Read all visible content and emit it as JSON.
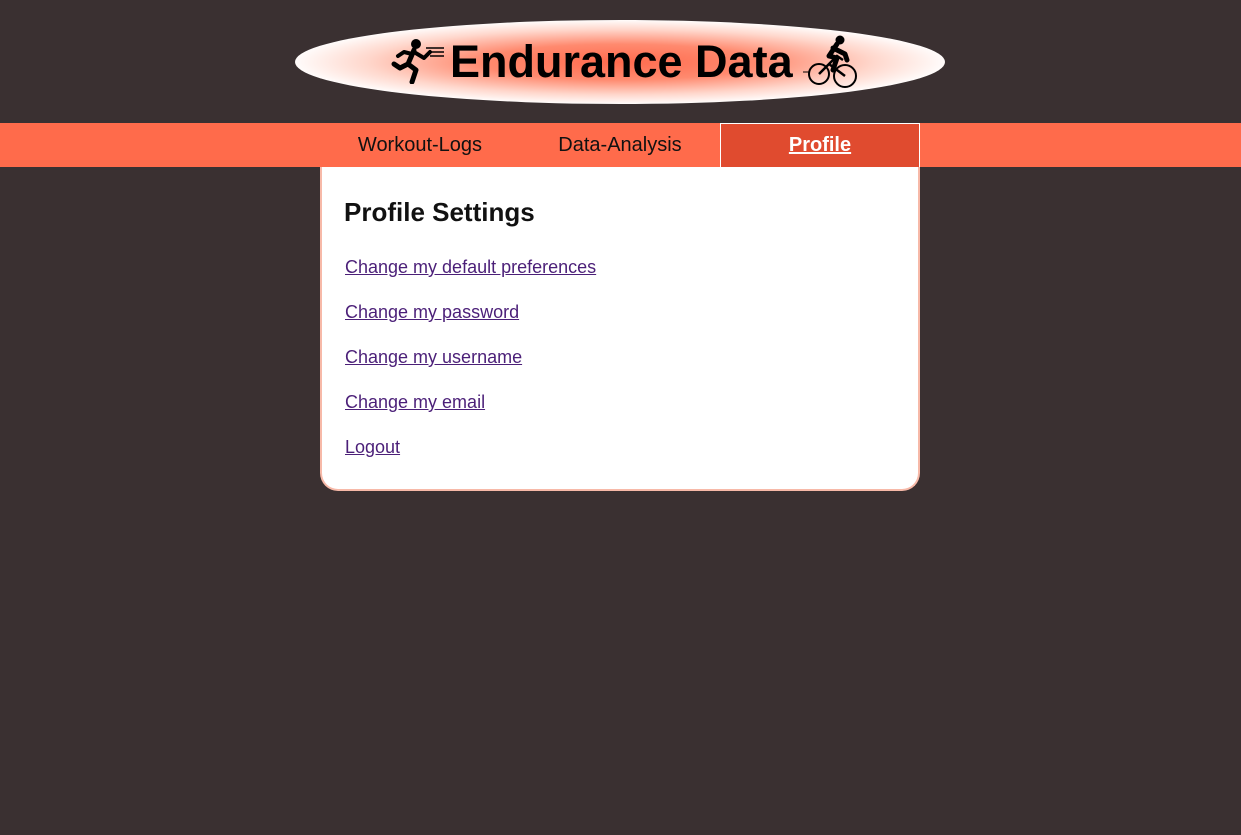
{
  "header": {
    "brand": "Endurance Data",
    "icons": [
      "runner-icon",
      "cyclist-icon"
    ]
  },
  "nav": {
    "tabs": [
      {
        "label": "Workout-Logs"
      },
      {
        "label": "Data-Analysis"
      },
      {
        "label": "Profile",
        "active": true
      }
    ]
  },
  "profile": {
    "title": "Profile Settings",
    "links": [
      {
        "label": "Change my default preferences"
      },
      {
        "label": "Change my password"
      },
      {
        "label": "Change my username"
      },
      {
        "label": "Change my email"
      },
      {
        "label": "Logout"
      }
    ]
  },
  "colors": {
    "background": "#3a3031",
    "nav": "#ff6b4b",
    "active_tab": "#e04b2f",
    "link": "#4b1f78"
  }
}
